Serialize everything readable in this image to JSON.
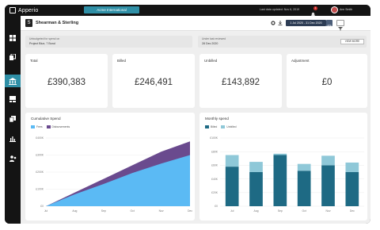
{
  "app": {
    "brand": "Apperio",
    "organization": "Acme International"
  },
  "topbar": {
    "last_updated": "Last data updated: Nov 6, 2019",
    "notification_count": "1",
    "user_name": "Ann Smith"
  },
  "sidebar": {
    "items": [
      {
        "icon": "dashboard-icon",
        "active": false
      },
      {
        "icon": "documents-icon",
        "active": false
      },
      {
        "icon": "bank-icon",
        "active": true
      },
      {
        "icon": "invoices-icon",
        "active": false
      },
      {
        "icon": "copy-icon",
        "active": false
      },
      {
        "icon": "bar-chart-icon",
        "active": false
      },
      {
        "icon": "people-icon",
        "active": false
      }
    ]
  },
  "header": {
    "client_initial": "S",
    "client_name": "Shearman & Sterling",
    "date_range": "1 Jul 2020 - 31 Dec 2020"
  },
  "info": {
    "left_label": "Unbudgeted for spend on",
    "left_value": "Project Blue, 7 Bond",
    "right_label": "Under last reviewed",
    "right_value": "28 Dec 2020",
    "view_more": "VIEW MORE"
  },
  "stats": [
    {
      "label": "Total",
      "value": "£390,383"
    },
    {
      "label": "Billed",
      "value": "£246,491"
    },
    {
      "label": "Unbilled",
      "value": "£143,892"
    },
    {
      "label": "Adjustment",
      "value": "£0"
    }
  ],
  "colors": {
    "accent": "#2f8fa6",
    "billed": "#1e6a84",
    "unbilled": "#8fc8d8",
    "fees": "#5bbaf4",
    "disbursements": "#6a4a8e"
  },
  "charts": {
    "cumulative_title": "Cumulative Spend",
    "monthly_title": "Monthly spend"
  },
  "chart_data": [
    {
      "type": "area",
      "title": "Cumulative Spend",
      "x": [
        "Jul",
        "Aug",
        "Sep",
        "Oct",
        "Nov",
        "Dec"
      ],
      "ylim": [
        0,
        400
      ],
      "y_ticks": [
        "£0",
        "£100K",
        "£200K",
        "£300K",
        "£400K"
      ],
      "series": [
        {
          "name": "Fees",
          "values": [
            0,
            70,
            130,
            195,
            250,
            300
          ]
        },
        {
          "name": "Disbursements",
          "values": [
            0,
            80,
            160,
            240,
            320,
            380
          ]
        }
      ]
    },
    {
      "type": "bar",
      "title": "Monthly spend",
      "categories": [
        "Jul",
        "Aug",
        "Sep",
        "Oct",
        "Nov",
        "Dec"
      ],
      "ylim": [
        0,
        100
      ],
      "y_ticks": [
        "£0",
        "£20K",
        "£40K",
        "£60K",
        "£80K",
        "£100K"
      ],
      "series": [
        {
          "name": "Billed",
          "values": [
            58,
            50,
            75,
            52,
            60,
            50
          ]
        },
        {
          "name": "Unbilled",
          "values": [
            17,
            15,
            2,
            10,
            14,
            14
          ]
        }
      ]
    }
  ]
}
